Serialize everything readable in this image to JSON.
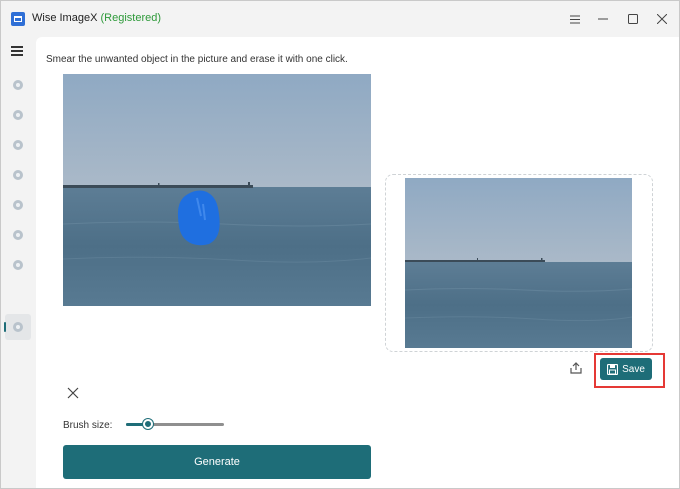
{
  "window": {
    "app_name": "Wise ImageX",
    "registered": "(Registered)"
  },
  "main": {
    "instruction": "Smear the unwanted object in the picture and erase it with one click.",
    "save_label": "Save",
    "brush_size_label": "Brush size:",
    "brush_size_fraction": 0.22,
    "generate_label": "Generate"
  },
  "colors": {
    "accent": "#1e6d78",
    "registered": "#2e9a3a",
    "highlight": "#e53935",
    "brush_mask": "#1f6fe0"
  },
  "icons": {
    "menu": "hamburger-icon",
    "share": "share-icon",
    "save": "save-icon",
    "close": "close-icon"
  }
}
